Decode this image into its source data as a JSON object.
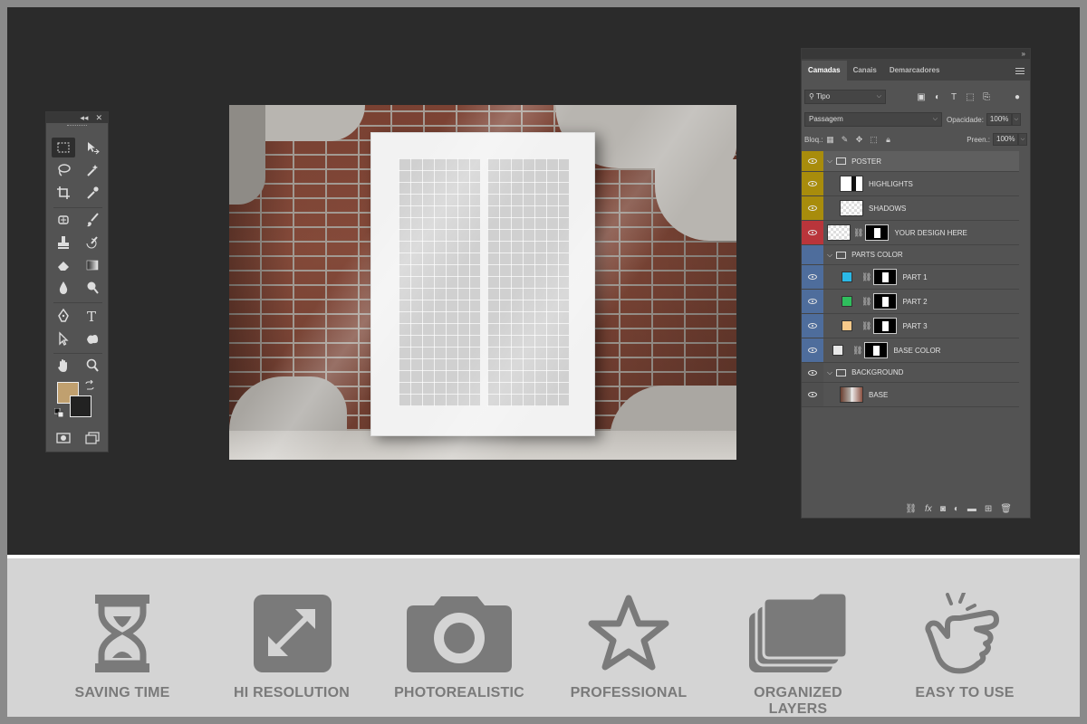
{
  "tools_panel": {
    "collapse_icon": "chevron-double-left-icon",
    "close_icon": "close-icon",
    "foreground_color": "#c0a06f",
    "background_color": "#222222"
  },
  "layers_panel": {
    "expand_label": "»",
    "tabs": [
      "Camadas",
      "Canais",
      "Demarcadores"
    ],
    "filter": {
      "value": "Tipo"
    },
    "blend": {
      "value": "Passagem"
    },
    "opacity": {
      "label": "Opacidade:",
      "value": "100%"
    },
    "lock": {
      "label": "Bloq.:"
    },
    "fill": {
      "label": "Preen.:",
      "value": "100%"
    },
    "layers": [
      {
        "name": "POSTER",
        "type": "group",
        "color": "#a88c0c"
      },
      {
        "name": "HIGHLIGHTS",
        "type": "layer",
        "color": "#a88c0c"
      },
      {
        "name": "SHADOWS",
        "type": "layer",
        "color": "#a88c0c"
      },
      {
        "name": "YOUR DESIGN HERE",
        "type": "smart",
        "color": "#b9353b"
      },
      {
        "name": "PARTS COLOR",
        "type": "group",
        "color": "#4e6d9c"
      },
      {
        "name": "PART 1",
        "type": "fill",
        "swatch": "#2bb8e6",
        "color": "#4e6d9c"
      },
      {
        "name": "PART 2",
        "type": "fill",
        "swatch": "#2fbf5d",
        "color": "#4e6d9c"
      },
      {
        "name": "PART 3",
        "type": "fill",
        "swatch": "#f7c98a",
        "color": "#4e6d9c"
      },
      {
        "name": "BASE COLOR",
        "type": "fill",
        "swatch": "#e8e8e8",
        "color": "#4e6d9c"
      },
      {
        "name": "BACKGROUND",
        "type": "group",
        "color": "#4f4f4f"
      },
      {
        "name": "BASE",
        "type": "photo",
        "color": "#4f4f4f"
      }
    ]
  },
  "features": [
    {
      "label": "SAVING TIME",
      "icon": "hourglass-icon"
    },
    {
      "label": "HI RESOLUTION",
      "icon": "resize-arrows-icon"
    },
    {
      "label": "PHOTOREALISTIC",
      "icon": "camera-icon"
    },
    {
      "label": "PROFESSIONAL",
      "icon": "star-icon"
    },
    {
      "label": "ORGANIZED LAYERS",
      "icon": "stacked-layers-icon"
    },
    {
      "label": "EASY TO USE",
      "icon": "pointing-hand-icon"
    }
  ]
}
